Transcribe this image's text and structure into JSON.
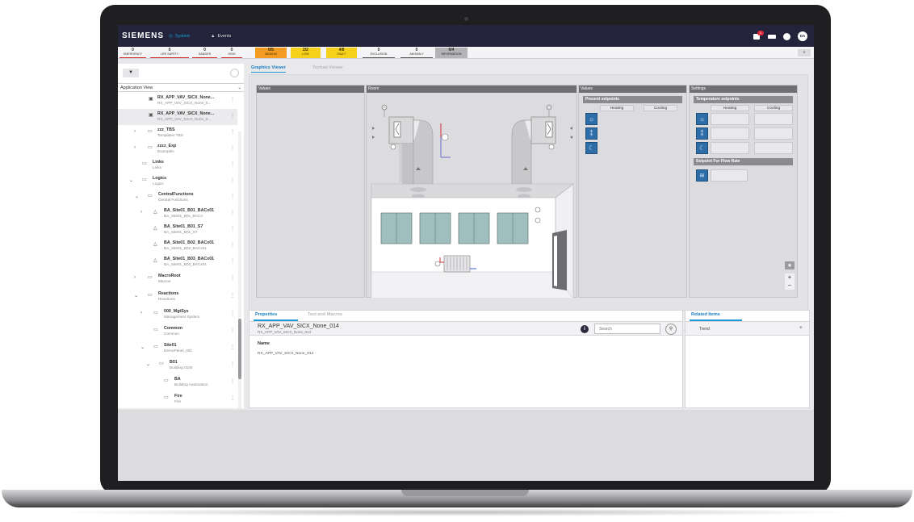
{
  "topbar": {
    "brand": "SIEMENS",
    "nav_system": "System",
    "nav_events": "Events",
    "notification_count": "1",
    "avatar": "DA"
  },
  "alarms": [
    {
      "count": "0",
      "label": "Emergency"
    },
    {
      "count": "0",
      "label": "Life Safety"
    },
    {
      "count": "0",
      "label": "Danger"
    },
    {
      "count": "0",
      "label": "High"
    },
    {
      "count": "0/5",
      "label": "Medium"
    },
    {
      "count": "2/2",
      "label": "Low"
    },
    {
      "count": "4/8",
      "label": "Fault"
    },
    {
      "count": "0",
      "label": "Exclusion"
    },
    {
      "count": "0",
      "label": "Anomaly"
    },
    {
      "count": "0/4",
      "label": "Information"
    }
  ],
  "tree": {
    "view": "Application View",
    "items": [
      {
        "title": "RX_APP_VAV_SICX_None...",
        "sub": "RX_APP_VAV_SICX_None_0..."
      },
      {
        "title": "RX_APP_VAV_SICX_None...",
        "sub": "RX_APP_VAV_SICX_None_0..."
      },
      {
        "title": "zzz_TBS",
        "sub": "Templates TBS"
      },
      {
        "title": "zzzz_Exp",
        "sub": "Examples"
      },
      {
        "title": "Links",
        "sub": "Links"
      },
      {
        "title": "Logics",
        "sub": "Logics"
      },
      {
        "title": "CentralFunctions",
        "sub": "Central Functions"
      },
      {
        "title": "BA_Site01_B01_BACx01",
        "sub": "BA_Site01_B0x_BACA"
      },
      {
        "title": "BA_Site01_B01_S7",
        "sub": "BA_Site01_B01_S7"
      },
      {
        "title": "BA_Site01_B02_BACx01",
        "sub": "BA_Site01_B02_BACx01"
      },
      {
        "title": "BA_Site01_B03_BACx01",
        "sub": "BA_Site01_B03_BACx01"
      },
      {
        "title": "MacroRoot",
        "sub": "Macros"
      },
      {
        "title": "Reactions",
        "sub": "Reactions"
      },
      {
        "title": "000_MgtSys",
        "sub": "Management System"
      },
      {
        "title": "Common",
        "sub": "Common"
      },
      {
        "title": "Site01",
        "sub": "DemoPanel_001"
      },
      {
        "title": "B01",
        "sub": "Building 0100"
      },
      {
        "title": "BA",
        "sub": "Building Automation"
      },
      {
        "title": "Fire",
        "sub": "Fire"
      }
    ]
  },
  "viewer": {
    "tab_graphics": "Graphics Viewer",
    "tab_textual": "Textual Viewer",
    "panel_values": "Values",
    "panel_room": "Room",
    "panel_values2": "Values",
    "panel_settings": "Settings",
    "present_setpoints": "Present setpoints",
    "temperature_setpoints": "Temperature setpoints",
    "heating": "Heating",
    "cooling": "Cooling",
    "setpoint_flow": "Setpoint For Flow Rate"
  },
  "properties": {
    "tab_properties": "Properties",
    "tab_text_macros": "Text and Macros",
    "object_title": "RX_APP_VAV_SICX_None_014",
    "object_sub": "RX_APP_VAV_SICX_None_014",
    "search_placeholder": "Search",
    "name_label": "Name",
    "name_value": "RX_APP_VAV_SICX_None_014"
  },
  "related": {
    "tab": "Related Items",
    "trend": "Trend"
  },
  "colors": {
    "topbar": "#23233c",
    "accent": "#1a9ad6",
    "medium": "#f39c21",
    "low": "#f6d11c",
    "setpoint_icon": "#2d6ea8"
  }
}
